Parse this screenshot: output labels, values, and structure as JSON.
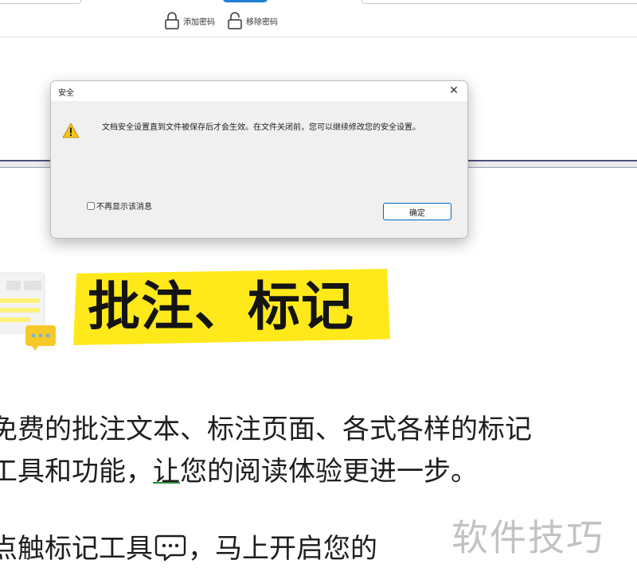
{
  "toolbar": {
    "add_password_label": "添加密码",
    "remove_password_label": "移除密码",
    "accent_color": "#1f7fd6"
  },
  "dialog": {
    "title": "安全",
    "close_symbol": "✕",
    "warning_icon": "warning-icon",
    "message": "文档安全设置直到文件被保存后才会生效。在文件关闭前，您可以继续修改您的安全设置。",
    "checkbox_label": "不再显示该消息",
    "checkbox_checked": false,
    "ok_label": "确定"
  },
  "content": {
    "heading": "批注、标记",
    "highlight_color": "#ffe91a",
    "paragraph1_line1": "免费的批注文本、标注页面、各式各样的标记",
    "paragraph1_line2_before": "工具和功能，",
    "paragraph1_line2_underlined": "让",
    "paragraph1_line2_after": "您的阅读体验更进一步。",
    "paragraph2_before": "点触标记工具",
    "paragraph2_after": "，马上开启您的",
    "inline_icon": "chat-bubble-icon"
  },
  "watermark": "软件技巧"
}
